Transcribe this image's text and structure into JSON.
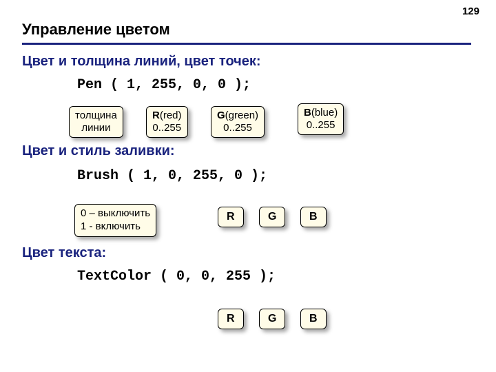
{
  "page_number": "129",
  "title": "Управление цветом",
  "sections": {
    "pen": {
      "heading": "Цвет и толщина линий, цвет точек:",
      "code": "Pen ( 1, 255, 0, 0 );",
      "callouts": {
        "thickness": "толщина\nлинии",
        "r": {
          "em": "R",
          "rest": "(red)",
          "range": "0..255"
        },
        "g": {
          "em": "G",
          "rest": "(green)",
          "range": "0..255"
        },
        "b": {
          "em": "B",
          "rest": "(blue)",
          "range": "0..255"
        }
      }
    },
    "brush": {
      "heading": "Цвет и стиль заливки:",
      "code": "Brush ( 1, 0, 255, 0 );",
      "toggle": "0 – выключить\n1 - включить",
      "minis": {
        "r": "R",
        "g": "G",
        "b": "B"
      }
    },
    "text": {
      "heading": "Цвет текста:",
      "code": "TextColor ( 0, 0, 255 );",
      "minis": {
        "r": "R",
        "g": "G",
        "b": "B"
      }
    }
  }
}
